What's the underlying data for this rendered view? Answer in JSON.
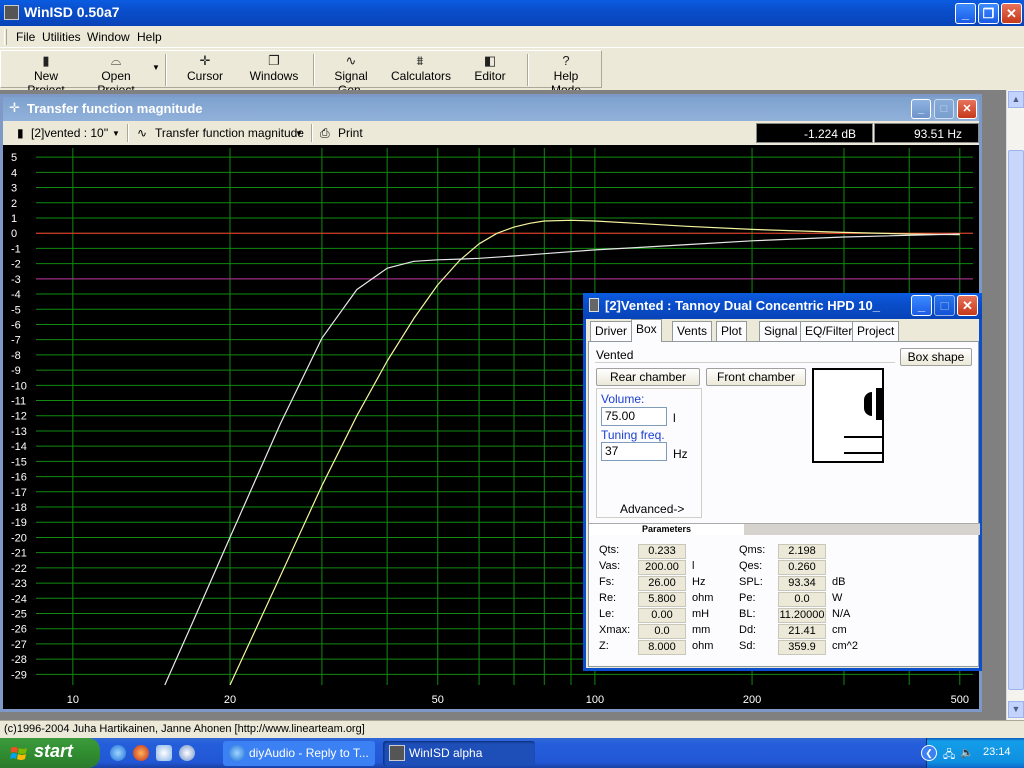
{
  "app": {
    "title": "WinISD 0.50a7",
    "menu": [
      "File",
      "Utilities",
      "Window",
      "Help"
    ],
    "toolbar": [
      {
        "label": "New Project",
        "icon": "new-project-icon"
      },
      {
        "label": "Open Project",
        "icon": "open-project-icon"
      },
      {
        "label": "Cursor",
        "icon": "cursor-icon"
      },
      {
        "label": "Windows",
        "icon": "windows-icon"
      },
      {
        "label": "Signal Gen.",
        "icon": "signal-gen-icon"
      },
      {
        "label": "Calculators",
        "icon": "calculators-icon"
      },
      {
        "label": "Editor",
        "icon": "editor-icon"
      },
      {
        "label": "Help Mode",
        "icon": "help-mode-icon"
      }
    ]
  },
  "chart_window": {
    "title": "Transfer function magnitude",
    "project_select": "[2]vented : 10''",
    "plot_select": "Transfer function magnitude",
    "print_label": "Print",
    "readout_db": "-1.224 dB",
    "readout_hz": "93.51 Hz"
  },
  "chart_data": {
    "type": "line",
    "xscale": "log",
    "xlim": [
      8.5,
      530
    ],
    "ylim": [
      -29.7,
      5.6
    ],
    "x_ticks": [
      10,
      20,
      50,
      100,
      200,
      500
    ],
    "y_ticks": [
      5,
      4,
      3,
      2,
      1,
      0,
      -1,
      -2,
      -3,
      -4,
      -5,
      -6,
      -7,
      -8,
      -9,
      -10,
      -11,
      -12,
      -13,
      -14,
      -15,
      -16,
      -17,
      -18,
      -19,
      -20,
      -21,
      -22,
      -23,
      -24,
      -25,
      -26,
      -27,
      -28,
      -29
    ],
    "reference_lines": [
      {
        "y": 0,
        "color": "#ff3030"
      },
      {
        "y": -3,
        "color": "#c020a0"
      }
    ],
    "series": [
      {
        "color": "#f5f5a0",
        "x": [
          20,
          25,
          30,
          35,
          40,
          45,
          50,
          55,
          60,
          65,
          70,
          75,
          80,
          90,
          100,
          120,
          150,
          200,
          300,
          400,
          500
        ],
        "y": [
          -29.7,
          -22.5,
          -16.6,
          -12.0,
          -8.4,
          -5.6,
          -3.4,
          -1.8,
          -0.7,
          0.0,
          0.4,
          0.65,
          0.8,
          0.85,
          0.8,
          0.65,
          0.45,
          0.25,
          0.05,
          -0.05,
          -0.1
        ]
      },
      {
        "color": "#e8e8e8",
        "x": [
          15,
          17,
          20,
          25,
          30,
          35,
          40,
          45,
          50,
          55,
          60,
          70,
          80,
          100,
          120,
          150,
          200,
          300,
          500
        ],
        "y": [
          -29.7,
          -25.5,
          -20.0,
          -12.5,
          -6.9,
          -3.7,
          -2.3,
          -1.85,
          -1.75,
          -1.7,
          -1.65,
          -1.5,
          -1.35,
          -1.1,
          -0.95,
          -0.75,
          -0.5,
          -0.25,
          -0.05
        ]
      }
    ]
  },
  "box_window": {
    "title": "[2]Vented : Tannoy Dual Concentric HPD 10_",
    "tabs": [
      "Driver",
      "Box",
      "Vents",
      "Plot",
      "Signal",
      "EQ/Filter",
      "Project"
    ],
    "box_type": "Vented",
    "box_shape_btn": "Box shape",
    "rear_chamber_btn": "Rear chamber",
    "front_chamber_btn": "Front chamber",
    "volume_label": "Volume:",
    "volume_value": "75.00",
    "volume_unit": "l",
    "tuning_label": "Tuning freq.",
    "tuning_value": "37",
    "tuning_unit": "Hz",
    "advanced_btn": "Advanced->",
    "params_header": "Parameters",
    "params_left": [
      {
        "name": "Qts:",
        "value": "0.233",
        "unit": ""
      },
      {
        "name": "Vas:",
        "value": "200.00",
        "unit": "l"
      },
      {
        "name": "Fs:",
        "value": "26.00",
        "unit": "Hz"
      },
      {
        "name": "Re:",
        "value": "5.800",
        "unit": "ohm"
      },
      {
        "name": "Le:",
        "value": "0.00",
        "unit": "mH"
      },
      {
        "name": "Xmax:",
        "value": "0.0",
        "unit": "mm"
      },
      {
        "name": "Z:",
        "value": "8.000",
        "unit": "ohm"
      }
    ],
    "params_right": [
      {
        "name": "Qms:",
        "value": "2.198",
        "unit": ""
      },
      {
        "name": "Qes:",
        "value": "0.260",
        "unit": ""
      },
      {
        "name": "SPL:",
        "value": "93.34",
        "unit": "dB"
      },
      {
        "name": "Pe:",
        "value": "0.0",
        "unit": "W"
      },
      {
        "name": "BL:",
        "value": "11.20000",
        "unit": "N/A"
      },
      {
        "name": "Dd:",
        "value": "21.41",
        "unit": "cm"
      },
      {
        "name": "Sd:",
        "value": "359.9",
        "unit": "cm^2"
      }
    ]
  },
  "status_text": "(c)1996-2004 Juha Hartikainen, Janne Ahonen [http://www.linearteam.org]",
  "taskbar": {
    "start_label": "start",
    "tasks": [
      "diyAudio - Reply to T...",
      "WinISD alpha"
    ],
    "clock": "23:14"
  }
}
